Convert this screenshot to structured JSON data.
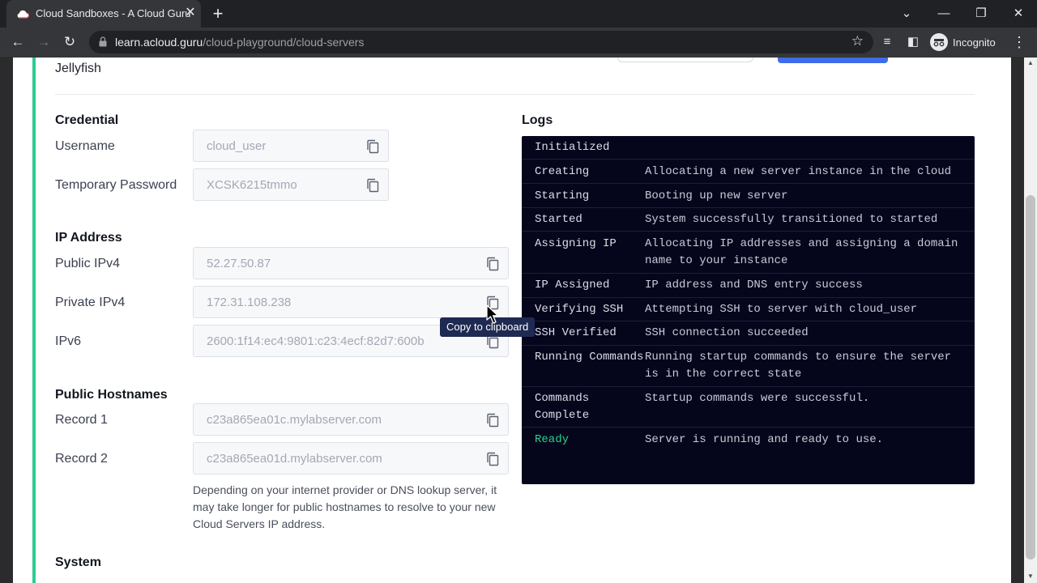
{
  "browser": {
    "tab_title": "Cloud Sandboxes - A Cloud Guru",
    "url_host": "learn.acloud.guru",
    "url_path": "/cloud-playground/cloud-servers",
    "profile_label": "Incognito"
  },
  "server": {
    "name": "Jellyfish"
  },
  "credential": {
    "title": "Credential",
    "username_label": "Username",
    "username_value": "cloud_user",
    "password_label": "Temporary Password",
    "password_value": "XCSK6215tmmo"
  },
  "ip": {
    "title": "IP Address",
    "public_label": "Public IPv4",
    "public_value": "52.27.50.87",
    "private_label": "Private IPv4",
    "private_value": "172.31.108.238",
    "ipv6_label": "IPv6",
    "ipv6_value": "2600:1f14:ec4:9801:c23:4ecf:82d7:600b"
  },
  "hostnames": {
    "title": "Public Hostnames",
    "record1_label": "Record 1",
    "record1_value": "c23a865ea01c.mylabserver.com",
    "record2_label": "Record 2",
    "record2_value": "c23a865ea01d.mylabserver.com",
    "note": "Depending on your internet provider or DNS lookup server, it may take longer for public hostnames to resolve to your new Cloud Servers IP address."
  },
  "system": {
    "title": "System"
  },
  "tooltip": {
    "text": "Copy to clipboard"
  },
  "logs": {
    "title": "Logs",
    "entries": [
      {
        "status": "Initialized",
        "message": ""
      },
      {
        "status": "Creating",
        "message": "Allocating a new server instance in the cloud"
      },
      {
        "status": "Starting",
        "message": "Booting up new server"
      },
      {
        "status": "Started",
        "message": "System successfully transitioned to started"
      },
      {
        "status": "Assigning IP",
        "message": "Allocating IP addresses and assigning a domain name to your instance"
      },
      {
        "status": "IP Assigned",
        "message": "IP address and DNS entry success"
      },
      {
        "status": "Verifying SSH",
        "message": "Attempting SSH to server with cloud_user"
      },
      {
        "status": "SSH Verified",
        "message": "SSH connection succeeded"
      },
      {
        "status": "Running Commands",
        "message": "Running startup commands to ensure the server is in the correct state"
      },
      {
        "status": "Commands Complete",
        "message": "Startup commands were successful."
      },
      {
        "status": "Ready",
        "message": "Server is running and ready to use."
      }
    ]
  },
  "colors": {
    "accent": "#2ecc8f",
    "ready": "#27d38a",
    "log_bg": "#05061c",
    "tooltip_bg": "#1f2a52"
  }
}
